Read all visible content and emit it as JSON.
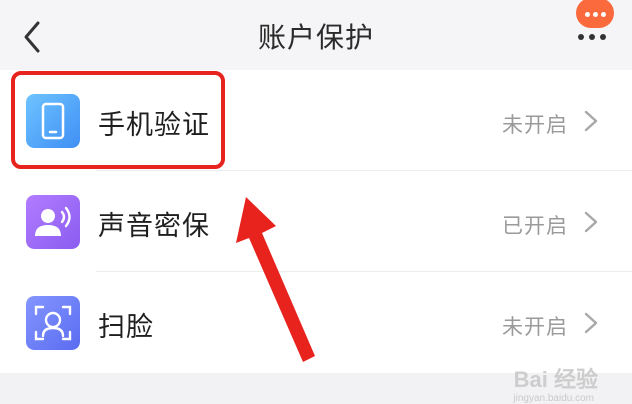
{
  "header": {
    "title": "账户保护",
    "back_icon": "chevron-left-icon",
    "more_icon": "more-dots-icon",
    "badge_color": "#fb6a3c"
  },
  "items": [
    {
      "label": "手机验证",
      "status": "未开启",
      "icon": "phone-icon",
      "color": "#52a8ff"
    },
    {
      "label": "声音密保",
      "status": "已开启",
      "icon": "voice-user-icon",
      "color": "#9f6cf5"
    },
    {
      "label": "扫脸",
      "status": "未开启",
      "icon": "face-scan-icon",
      "color": "#6a7ef8"
    }
  ],
  "annotation": {
    "highlight_color": "#e8231e",
    "arrow_color": "#e8231e"
  },
  "watermark": {
    "text": "Bai 经验",
    "sub": "jingyan.baidu.com"
  }
}
